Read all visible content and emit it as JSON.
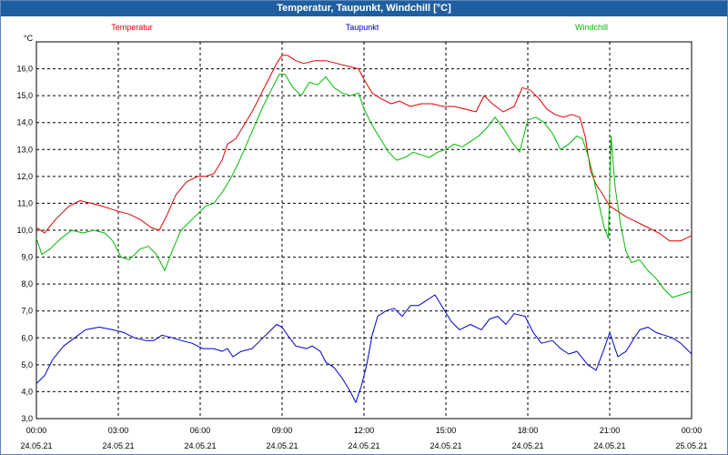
{
  "window_title": "Temperatur, Taupunkt, Windchill [°C]",
  "chart_data": {
    "type": "line",
    "title": "Temperatur, Taupunkt, Windchill [°C]",
    "ylabel": "°C",
    "ylim": [
      3.0,
      17.0
    ],
    "xlim_hours": [
      0,
      24
    ],
    "y_ticks": [
      "3,0",
      "4,0",
      "5,0",
      "6,0",
      "7,0",
      "8,0",
      "9,0",
      "10,0",
      "11,0",
      "12,0",
      "13,0",
      "14,0",
      "15,0",
      "16,0"
    ],
    "x_ticks": [
      {
        "time": "00:00",
        "date": "24.05.21"
      },
      {
        "time": "03:00",
        "date": "24.05.21"
      },
      {
        "time": "06:00",
        "date": "24.05.21"
      },
      {
        "time": "09:00",
        "date": "24.05.21"
      },
      {
        "time": "12:00",
        "date": "24.05.21"
      },
      {
        "time": "15:00",
        "date": "24.05.21"
      },
      {
        "time": "18:00",
        "date": "24.05.21"
      },
      {
        "time": "21:00",
        "date": "24.05.21"
      },
      {
        "time": "00:00",
        "date": "25.05.21"
      }
    ],
    "grid": true,
    "legend_position": "top",
    "series": [
      {
        "name": "Temperatur",
        "color": "#e00000",
        "points": [
          [
            0,
            10.1
          ],
          [
            0.3,
            9.9
          ],
          [
            0.7,
            10.4
          ],
          [
            1.2,
            10.9
          ],
          [
            1.6,
            11.1
          ],
          [
            2.0,
            11.0
          ],
          [
            2.4,
            10.9
          ],
          [
            2.7,
            10.8
          ],
          [
            3.0,
            10.7
          ],
          [
            3.4,
            10.6
          ],
          [
            3.8,
            10.4
          ],
          [
            4.2,
            10.1
          ],
          [
            4.5,
            10.0
          ],
          [
            4.8,
            10.6
          ],
          [
            5.1,
            11.3
          ],
          [
            5.5,
            11.8
          ],
          [
            5.9,
            12.0
          ],
          [
            6.2,
            12.0
          ],
          [
            6.5,
            12.1
          ],
          [
            6.8,
            12.6
          ],
          [
            7.0,
            13.2
          ],
          [
            7.3,
            13.4
          ],
          [
            7.6,
            13.9
          ],
          [
            7.9,
            14.4
          ],
          [
            8.1,
            14.8
          ],
          [
            8.3,
            15.2
          ],
          [
            8.6,
            15.8
          ],
          [
            8.8,
            16.2
          ],
          [
            9.0,
            16.5
          ],
          [
            9.2,
            16.5
          ],
          [
            9.5,
            16.3
          ],
          [
            9.8,
            16.2
          ],
          [
            10.2,
            16.3
          ],
          [
            10.6,
            16.3
          ],
          [
            11.0,
            16.2
          ],
          [
            11.4,
            16.1
          ],
          [
            11.8,
            16.0
          ],
          [
            12.0,
            15.6
          ],
          [
            12.3,
            15.1
          ],
          [
            12.6,
            14.9
          ],
          [
            13.0,
            14.7
          ],
          [
            13.3,
            14.8
          ],
          [
            13.7,
            14.6
          ],
          [
            14.1,
            14.7
          ],
          [
            14.5,
            14.7
          ],
          [
            14.9,
            14.6
          ],
          [
            15.3,
            14.6
          ],
          [
            15.7,
            14.5
          ],
          [
            16.1,
            14.4
          ],
          [
            16.4,
            15.0
          ],
          [
            16.7,
            14.7
          ],
          [
            17.1,
            14.4
          ],
          [
            17.5,
            14.6
          ],
          [
            17.8,
            15.3
          ],
          [
            18.1,
            15.2
          ],
          [
            18.4,
            14.9
          ],
          [
            18.7,
            14.5
          ],
          [
            19.0,
            14.3
          ],
          [
            19.3,
            14.2
          ],
          [
            19.6,
            14.3
          ],
          [
            19.9,
            14.2
          ],
          [
            20.1,
            13.5
          ],
          [
            20.3,
            12.2
          ],
          [
            20.5,
            11.7
          ],
          [
            20.7,
            11.4
          ],
          [
            21.0,
            10.9
          ],
          [
            21.3,
            10.7
          ],
          [
            21.6,
            10.5
          ],
          [
            22.0,
            10.3
          ],
          [
            22.4,
            10.1
          ],
          [
            22.8,
            9.9
          ],
          [
            23.2,
            9.6
          ],
          [
            23.6,
            9.6
          ],
          [
            24.0,
            9.8
          ]
        ]
      },
      {
        "name": "Taupunkt",
        "color": "#0000cc",
        "points": [
          [
            0,
            4.3
          ],
          [
            0.3,
            4.6
          ],
          [
            0.6,
            5.2
          ],
          [
            1.0,
            5.7
          ],
          [
            1.4,
            6.0
          ],
          [
            1.8,
            6.3
          ],
          [
            2.3,
            6.4
          ],
          [
            2.8,
            6.3
          ],
          [
            3.2,
            6.2
          ],
          [
            3.6,
            6.0
          ],
          [
            4.0,
            5.9
          ],
          [
            4.3,
            5.9
          ],
          [
            4.6,
            6.1
          ],
          [
            5.0,
            6.0
          ],
          [
            5.3,
            5.9
          ],
          [
            5.7,
            5.8
          ],
          [
            6.1,
            5.6
          ],
          [
            6.5,
            5.6
          ],
          [
            6.8,
            5.5
          ],
          [
            7.0,
            5.6
          ],
          [
            7.2,
            5.3
          ],
          [
            7.5,
            5.5
          ],
          [
            7.9,
            5.6
          ],
          [
            8.2,
            5.9
          ],
          [
            8.5,
            6.2
          ],
          [
            8.8,
            6.5
          ],
          [
            9.0,
            6.4
          ],
          [
            9.2,
            6.1
          ],
          [
            9.5,
            5.7
          ],
          [
            9.9,
            5.6
          ],
          [
            10.1,
            5.7
          ],
          [
            10.4,
            5.5
          ],
          [
            10.6,
            5.1
          ],
          [
            10.9,
            4.9
          ],
          [
            11.2,
            4.5
          ],
          [
            11.5,
            4.0
          ],
          [
            11.7,
            3.6
          ],
          [
            11.9,
            4.2
          ],
          [
            12.1,
            5.0
          ],
          [
            12.3,
            6.1
          ],
          [
            12.5,
            6.8
          ],
          [
            12.8,
            7.0
          ],
          [
            13.1,
            7.1
          ],
          [
            13.4,
            6.8
          ],
          [
            13.7,
            7.2
          ],
          [
            14.0,
            7.2
          ],
          [
            14.3,
            7.4
          ],
          [
            14.6,
            7.6
          ],
          [
            14.9,
            7.1
          ],
          [
            15.2,
            6.6
          ],
          [
            15.5,
            6.3
          ],
          [
            15.9,
            6.5
          ],
          [
            16.3,
            6.3
          ],
          [
            16.6,
            6.7
          ],
          [
            16.9,
            6.8
          ],
          [
            17.2,
            6.5
          ],
          [
            17.5,
            6.9
          ],
          [
            17.9,
            6.8
          ],
          [
            18.2,
            6.2
          ],
          [
            18.5,
            5.8
          ],
          [
            18.9,
            5.9
          ],
          [
            19.2,
            5.6
          ],
          [
            19.5,
            5.4
          ],
          [
            19.8,
            5.5
          ],
          [
            20.2,
            5.0
          ],
          [
            20.5,
            4.8
          ],
          [
            20.8,
            5.6
          ],
          [
            21.0,
            6.2
          ],
          [
            21.3,
            5.3
          ],
          [
            21.6,
            5.5
          ],
          [
            21.9,
            6.0
          ],
          [
            22.1,
            6.3
          ],
          [
            22.4,
            6.4
          ],
          [
            22.7,
            6.2
          ],
          [
            23.0,
            6.1
          ],
          [
            23.3,
            6.0
          ],
          [
            23.6,
            5.8
          ],
          [
            24.0,
            5.4
          ]
        ]
      },
      {
        "name": "Windchill",
        "color": "#00bb00",
        "points": [
          [
            0,
            9.7
          ],
          [
            0.2,
            9.1
          ],
          [
            0.5,
            9.3
          ],
          [
            0.9,
            9.7
          ],
          [
            1.3,
            10.0
          ],
          [
            1.7,
            9.9
          ],
          [
            2.1,
            10.0
          ],
          [
            2.5,
            9.9
          ],
          [
            2.8,
            9.6
          ],
          [
            3.1,
            9.0
          ],
          [
            3.4,
            8.9
          ],
          [
            3.8,
            9.3
          ],
          [
            4.1,
            9.4
          ],
          [
            4.4,
            9.1
          ],
          [
            4.7,
            8.5
          ],
          [
            5.0,
            9.3
          ],
          [
            5.3,
            10.0
          ],
          [
            5.6,
            10.3
          ],
          [
            5.9,
            10.6
          ],
          [
            6.2,
            10.9
          ],
          [
            6.5,
            11.0
          ],
          [
            6.8,
            11.4
          ],
          [
            7.1,
            11.9
          ],
          [
            7.4,
            12.5
          ],
          [
            7.7,
            13.2
          ],
          [
            8.0,
            13.9
          ],
          [
            8.3,
            14.6
          ],
          [
            8.6,
            15.2
          ],
          [
            8.9,
            15.8
          ],
          [
            9.1,
            15.8
          ],
          [
            9.4,
            15.3
          ],
          [
            9.7,
            15.0
          ],
          [
            10.0,
            15.5
          ],
          [
            10.3,
            15.4
          ],
          [
            10.6,
            15.7
          ],
          [
            10.9,
            15.3
          ],
          [
            11.2,
            15.1
          ],
          [
            11.5,
            15.0
          ],
          [
            11.8,
            15.1
          ],
          [
            12.0,
            14.5
          ],
          [
            12.3,
            13.9
          ],
          [
            12.6,
            13.4
          ],
          [
            12.9,
            12.9
          ],
          [
            13.2,
            12.6
          ],
          [
            13.5,
            12.7
          ],
          [
            13.8,
            12.9
          ],
          [
            14.1,
            12.8
          ],
          [
            14.4,
            12.7
          ],
          [
            14.7,
            12.9
          ],
          [
            15.0,
            13.0
          ],
          [
            15.3,
            13.2
          ],
          [
            15.6,
            13.1
          ],
          [
            15.9,
            13.3
          ],
          [
            16.2,
            13.5
          ],
          [
            16.5,
            13.8
          ],
          [
            16.8,
            14.2
          ],
          [
            17.1,
            13.8
          ],
          [
            17.4,
            13.3
          ],
          [
            17.7,
            12.9
          ],
          [
            18.0,
            14.1
          ],
          [
            18.3,
            14.2
          ],
          [
            18.6,
            14.0
          ],
          [
            18.9,
            13.6
          ],
          [
            19.2,
            13.0
          ],
          [
            19.5,
            13.2
          ],
          [
            19.8,
            13.5
          ],
          [
            20.0,
            13.4
          ],
          [
            20.2,
            12.8
          ],
          [
            20.4,
            12.0
          ],
          [
            20.6,
            11.0
          ],
          [
            20.8,
            10.1
          ],
          [
            20.95,
            9.7
          ],
          [
            21.05,
            13.5
          ],
          [
            21.2,
            11.6
          ],
          [
            21.4,
            10.2
          ],
          [
            21.6,
            9.2
          ],
          [
            21.8,
            8.8
          ],
          [
            22.1,
            8.9
          ],
          [
            22.4,
            8.5
          ],
          [
            22.7,
            8.2
          ],
          [
            23.0,
            7.8
          ],
          [
            23.3,
            7.5
          ],
          [
            23.6,
            7.6
          ],
          [
            23.9,
            7.7
          ],
          [
            24.0,
            7.7
          ]
        ]
      }
    ]
  }
}
